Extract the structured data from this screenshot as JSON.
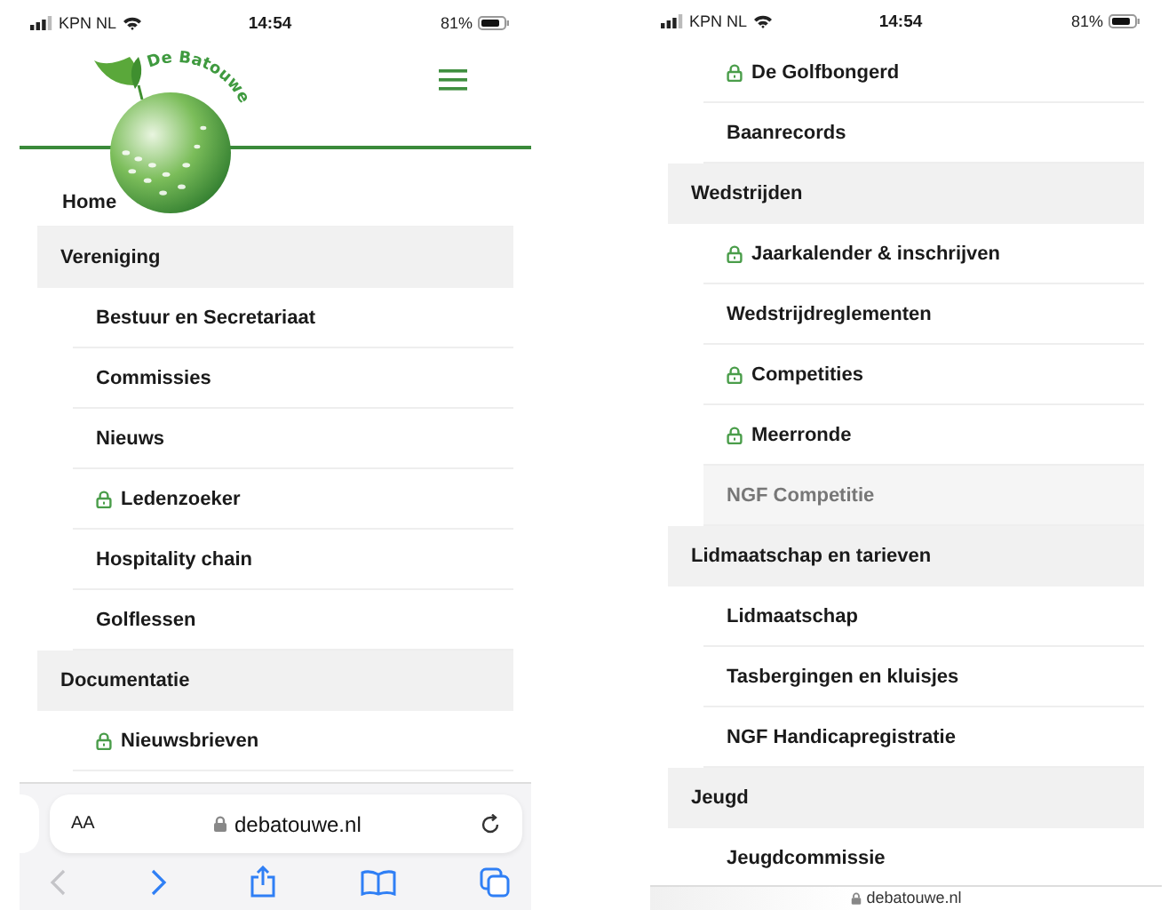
{
  "screens": [
    {
      "status_bar": {
        "carrier": "KPN NL",
        "time": "14:54",
        "battery": "81%"
      },
      "header": {
        "logo_text": "De Batouwe"
      },
      "menu": [
        {
          "label": "Home",
          "kind": "top",
          "locked": false,
          "selected": false
        },
        {
          "label": "Vereniging",
          "kind": "section",
          "locked": false,
          "selected": false
        },
        {
          "label": "Bestuur en Secretariaat",
          "kind": "item",
          "locked": false,
          "selected": false
        },
        {
          "label": "Commissies",
          "kind": "item",
          "locked": false,
          "selected": false
        },
        {
          "label": "Nieuws",
          "kind": "item",
          "locked": false,
          "selected": false
        },
        {
          "label": "Ledenzoeker",
          "kind": "item",
          "locked": true,
          "selected": false
        },
        {
          "label": "Hospitality chain",
          "kind": "item",
          "locked": false,
          "selected": false
        },
        {
          "label": "Golflessen",
          "kind": "item",
          "locked": false,
          "selected": false
        },
        {
          "label": "Documentatie",
          "kind": "section",
          "locked": false,
          "selected": false
        },
        {
          "label": "Nieuwsbrieven",
          "kind": "item",
          "locked": true,
          "selected": false
        }
      ],
      "browser": {
        "kind": "full",
        "text_size": "AA",
        "url": "debatouwe.nl"
      }
    },
    {
      "status_bar": {
        "carrier": "KPN NL",
        "time": "14:54",
        "battery": "81%"
      },
      "menu": [
        {
          "label": "De Golfbongerd",
          "kind": "item",
          "locked": true,
          "selected": false
        },
        {
          "label": "Baanrecords",
          "kind": "item",
          "locked": false,
          "selected": false
        },
        {
          "label": "Wedstrijden",
          "kind": "section",
          "locked": false,
          "selected": false
        },
        {
          "label": "Jaarkalender & inschrijven",
          "kind": "item",
          "locked": true,
          "selected": false
        },
        {
          "label": "Wedstrijdreglementen",
          "kind": "item",
          "locked": false,
          "selected": false
        },
        {
          "label": "Competities",
          "kind": "item",
          "locked": true,
          "selected": false
        },
        {
          "label": "Meerronde",
          "kind": "item",
          "locked": true,
          "selected": false
        },
        {
          "label": "NGF Competitie",
          "kind": "item",
          "locked": false,
          "selected": true
        },
        {
          "label": "Lidmaatschap en tarieven",
          "kind": "section",
          "locked": false,
          "selected": false
        },
        {
          "label": "Lidmaatschap",
          "kind": "item",
          "locked": false,
          "selected": false
        },
        {
          "label": "Tasbergingen en kluisjes",
          "kind": "item",
          "locked": false,
          "selected": false
        },
        {
          "label": "NGF Handicapregistratie",
          "kind": "item",
          "locked": false,
          "selected": false
        },
        {
          "label": "Jeugd",
          "kind": "section",
          "locked": false,
          "selected": false
        },
        {
          "label": "Jeugdcommissie",
          "kind": "item",
          "locked": false,
          "selected": false
        }
      ],
      "browser": {
        "kind": "compact",
        "url": "debatouwe.nl"
      }
    }
  ]
}
